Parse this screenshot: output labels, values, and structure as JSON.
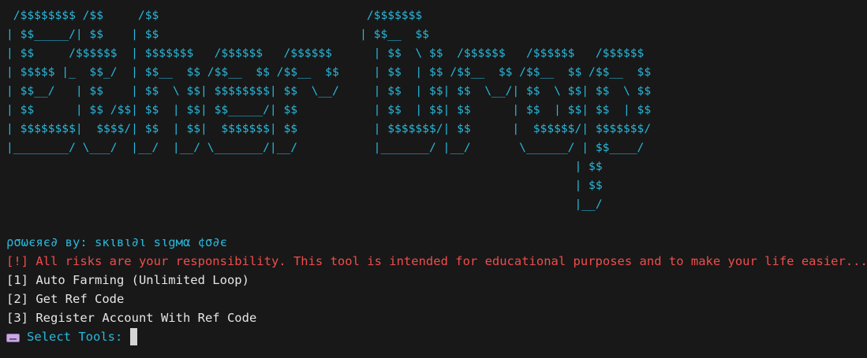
{
  "banner": {
    "ascii_art": " /$$$$$$$$ /$$     /$$                              /$$$$$$$\n| $$_____/| $$    | $$                             | $$__  $$\n| $$     /$$$$$$  | $$$$$$$   /$$$$$$   /$$$$$$      | $$  \\ $$  /$$$$$$   /$$$$$$   /$$$$$$\n| $$$$$ |_  $$_/  | $$__  $$ /$$__  $$ /$$__  $$     | $$  | $$ /$$__  $$ /$$__  $$ /$$__  $$\n| $$__/   | $$    | $$  \\ $$| $$$$$$$$| $$  \\__/     | $$  | $$| $$  \\__/| $$  \\ $$| $$  \\ $$\n| $$      | $$ /$$| $$  | $$| $$_____/| $$           | $$  | $$| $$      | $$  | $$| $$  | $$\n| $$$$$$$$|  $$$$/| $$  | $$|  $$$$$$$| $$           | $$$$$$$/| $$      |  $$$$$$/| $$$$$$$/\n|________/ \\___/  |__/  |__/ \\_______/|__/           |_______/ |__/       \\______/ | $$____/\n                                                                                  | $$\n                                                                                  | $$\n                                                                                  |__/"
  },
  "powered_by": "ρσωєяє∂ ву: ѕкιвι∂ι ѕιgмα ¢σ∂є",
  "warning": "[!] All risks are your responsibility. This tool is intended for educational purposes and to make your life easier.....",
  "menu": {
    "items": [
      "[1] Auto Farming (Unlimited Loop)",
      "[2] Get Ref Code",
      "[3] Register Account With Ref Code"
    ]
  },
  "prompt": {
    "icon": "keyboard-icon",
    "label": "Select Tools:"
  },
  "colors": {
    "background": "#181818",
    "cyan": "#29b8db",
    "red": "#f14c4c",
    "text": "#e6e6e6"
  }
}
